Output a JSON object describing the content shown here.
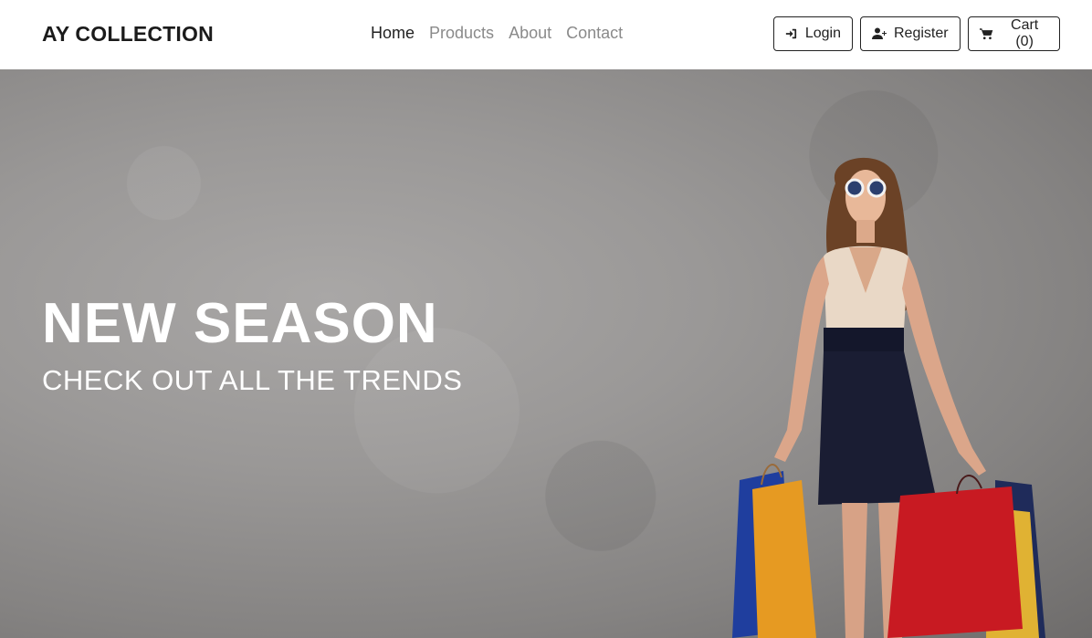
{
  "brand": {
    "name": "AY COLLECTION"
  },
  "nav": {
    "links": [
      {
        "label": "Home",
        "active": true
      },
      {
        "label": "Products",
        "active": false
      },
      {
        "label": "About",
        "active": false
      },
      {
        "label": "Contact",
        "active": false
      }
    ],
    "actions": {
      "login_label": "Login",
      "register_label": "Register",
      "cart_label": "Cart (0)"
    }
  },
  "hero": {
    "title": "NEW SEASON",
    "subtitle": "CHECK OUT ALL THE TRENDS"
  },
  "colors": {
    "text_dark": "#222222",
    "nav_inactive": "#8a8a8a",
    "hero_bg": "#9a9897"
  }
}
